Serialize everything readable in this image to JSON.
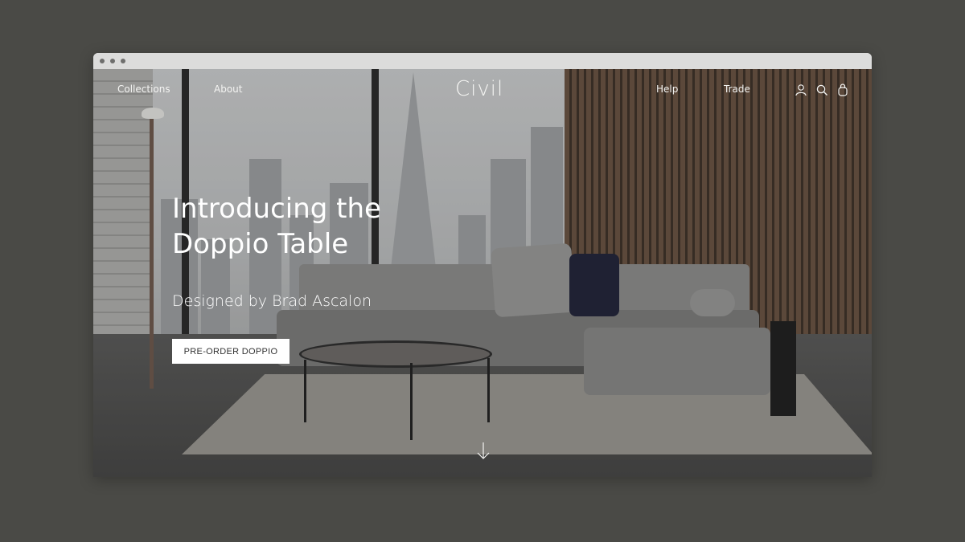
{
  "nav": {
    "left_links": [
      "Collections",
      "About"
    ],
    "logo": "Civil",
    "right_links": [
      "Help",
      "Trade"
    ],
    "icons": [
      "account-icon",
      "search-icon",
      "bag-icon"
    ]
  },
  "hero": {
    "title": "Introducing the Doppio Table",
    "subtitle": "Designed by Brad Ascalon",
    "cta_label": "PRE-ORDER DOPPIO"
  },
  "scroll_icon": "arrow-down-icon",
  "colors": {
    "background": "#4a4a46",
    "nav_text": "#f4f4f2",
    "cta_bg": "#ffffff",
    "cta_text": "#333333"
  }
}
